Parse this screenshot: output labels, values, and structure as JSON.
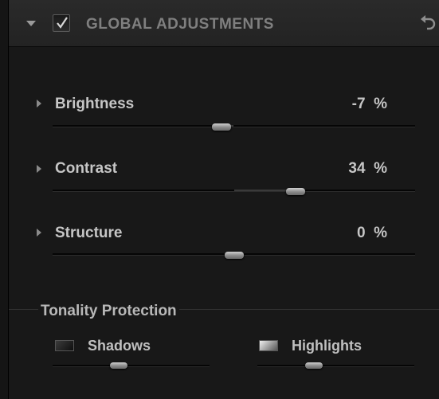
{
  "header": {
    "title": "GLOBAL ADJUSTMENTS",
    "enabled": true,
    "icons": {
      "collapse": "collapse-triangle-icon",
      "check": "checkmark-icon",
      "reset": "undo-icon"
    }
  },
  "adjustments": [
    {
      "label": "Brightness",
      "value": "-7",
      "unit": "%",
      "level": -0.07
    },
    {
      "label": "Contrast",
      "value": "34",
      "unit": "%",
      "level": 0.34
    },
    {
      "label": "Structure",
      "value": "0",
      "unit": "%",
      "level": 0
    }
  ],
  "tonality": {
    "title": "Tonality Protection",
    "shadows": {
      "label": "Shadows",
      "level": 0.42
    },
    "highlights": {
      "label": "Highlights",
      "level": 0.36
    }
  },
  "colors": {
    "panel": "#181818",
    "header": "#262626",
    "title": "#7f7f7f",
    "text": "#c6c6c6"
  }
}
